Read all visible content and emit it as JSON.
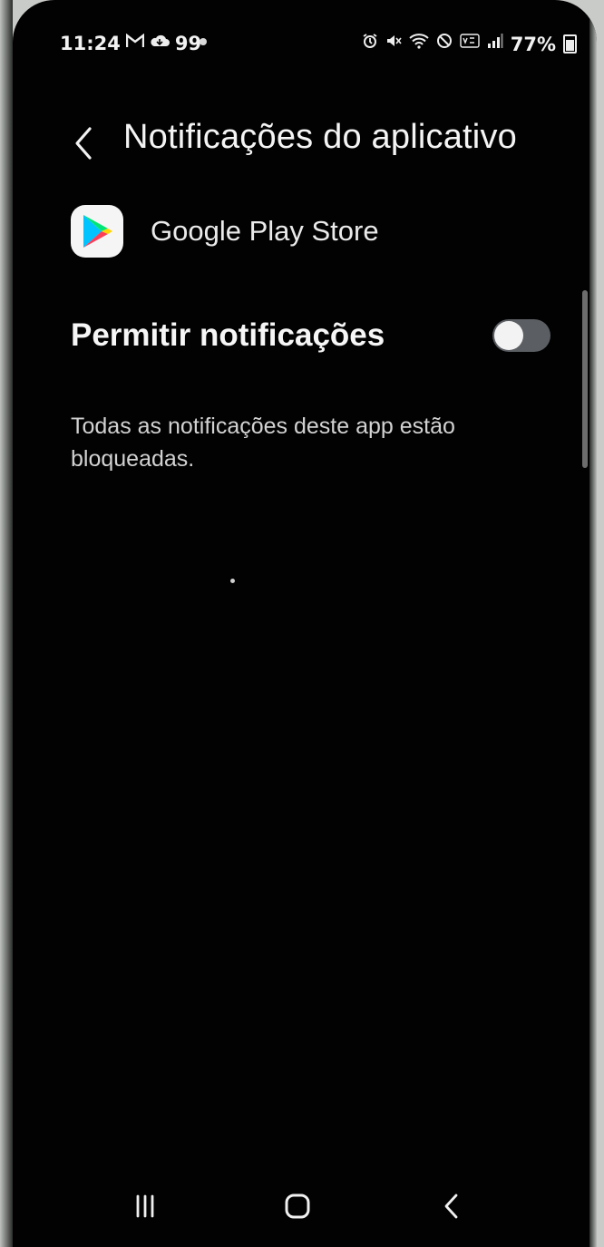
{
  "statusbar": {
    "time": "11:24",
    "left_icons": [
      "gmail-icon",
      "cloud-icon"
    ],
    "notification_count": "99",
    "battery_text": "77%",
    "right_icons": [
      "alarm-icon",
      "mute-icon",
      "wifi-icon",
      "block-icon",
      "volte-icon",
      "signal-icon",
      "battery-icon"
    ]
  },
  "header": {
    "title": "Notificações do aplicativo",
    "back_icon": "chevron-left-icon"
  },
  "app": {
    "name": "Google Play Store",
    "icon": "google-play-icon"
  },
  "toggle": {
    "label": "Permitir notificações",
    "state": "off"
  },
  "info": {
    "text": "Todas as notificações deste app estão bloqueadas."
  },
  "navbar": {
    "recents_icon": "recents-icon",
    "home_icon": "home-icon",
    "back_icon": "back-icon"
  },
  "colors": {
    "background": "#020202",
    "text": "#f4f4f4",
    "switch_track_off": "#5b5e62"
  }
}
